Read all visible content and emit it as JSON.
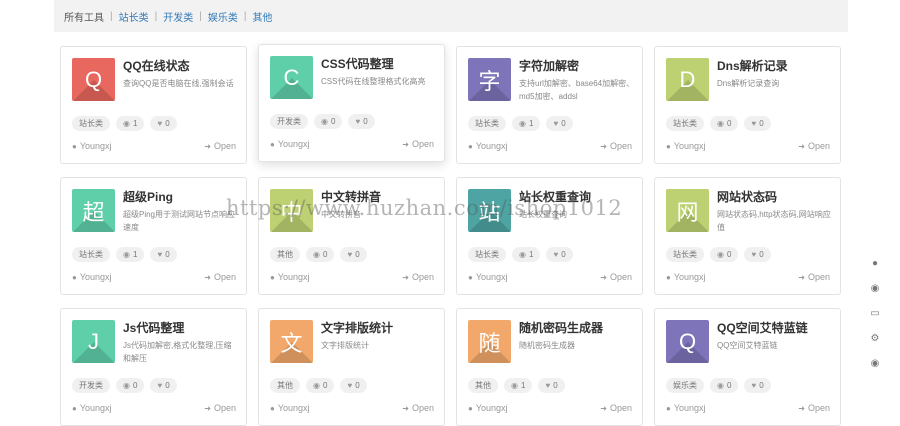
{
  "breadcrumb": {
    "root": "所有工具",
    "categories": [
      "站长类",
      "开发类",
      "娱乐类",
      "其他"
    ]
  },
  "cards": [
    {
      "icon_char": "Q",
      "color": "#e8675e",
      "title": "QQ在线状态",
      "desc": "查询QQ是否电脑在线,强制会话",
      "tag": "站长类",
      "views": "1",
      "likes": "0",
      "author": "Youngxj",
      "open": "Open"
    },
    {
      "icon_char": "C",
      "color": "#5fcfaa",
      "title": "CSS代码整理",
      "desc": "CSS代码在线整理格式化高亮",
      "tag": "开发类",
      "views": "0",
      "likes": "0",
      "author": "Youngxj",
      "open": "Open"
    },
    {
      "icon_char": "字",
      "color": "#7d74b9",
      "title": "字符加解密",
      "desc": "支持url加解密、base64加解密、md5加密、addsl",
      "tag": "站长类",
      "views": "1",
      "likes": "0",
      "author": "Youngxj",
      "open": "Open"
    },
    {
      "icon_char": "D",
      "color": "#bdd172",
      "title": "Dns解析记录",
      "desc": "Dns解析记录查询",
      "tag": "站长类",
      "views": "0",
      "likes": "0",
      "author": "Youngxj",
      "open": "Open"
    },
    {
      "icon_char": "超",
      "color": "#5fcfaa",
      "title": "超级Ping",
      "desc": "超级Ping用于测试网站节点响应速度",
      "tag": "站长类",
      "views": "1",
      "likes": "0",
      "author": "Youngxj",
      "open": "Open"
    },
    {
      "icon_char": "中",
      "color": "#bdd172",
      "title": "中文转拼音",
      "desc": "中文转拼音",
      "tag": "其他",
      "views": "0",
      "likes": "0",
      "author": "Youngxj",
      "open": "Open"
    },
    {
      "icon_char": "站",
      "color": "#4ea3a3",
      "title": "站长权重查询",
      "desc": "站长权重查询",
      "tag": "站长类",
      "views": "1",
      "likes": "0",
      "author": "Youngxj",
      "open": "Open"
    },
    {
      "icon_char": "网",
      "color": "#bdd172",
      "title": "网站状态码",
      "desc": "网站状态码,http状态码,网站响应值",
      "tag": "站长类",
      "views": "0",
      "likes": "0",
      "author": "Youngxj",
      "open": "Open"
    },
    {
      "icon_char": "J",
      "color": "#5fcfaa",
      "title": "Js代码整理",
      "desc": "Js代码加解密,格式化整理,压缩和解压",
      "tag": "开发类",
      "views": "0",
      "likes": "0",
      "author": "Youngxj",
      "open": "Open"
    },
    {
      "icon_char": "文",
      "color": "#f2a86b",
      "title": "文字排版统计",
      "desc": "文字排版统计",
      "tag": "其他",
      "views": "0",
      "likes": "0",
      "author": "Youngxj",
      "open": "Open"
    },
    {
      "icon_char": "随",
      "color": "#f2a86b",
      "title": "随机密码生成器",
      "desc": "随机密码生成器",
      "tag": "其他",
      "views": "1",
      "likes": "0",
      "author": "Youngxj",
      "open": "Open"
    },
    {
      "icon_char": "Q",
      "color": "#7d74b9",
      "title": "QQ空间艾特蓝链",
      "desc": "QQ空间艾特蓝链",
      "tag": "娱乐类",
      "views": "0",
      "likes": "0",
      "author": "Youngxj",
      "open": "Open"
    }
  ],
  "sidebar_icons": [
    "qq-icon",
    "weibo-icon",
    "monitor-icon",
    "gear-icon",
    "github-icon"
  ],
  "watermark": "https://www.huzhan.com/ishop1012"
}
